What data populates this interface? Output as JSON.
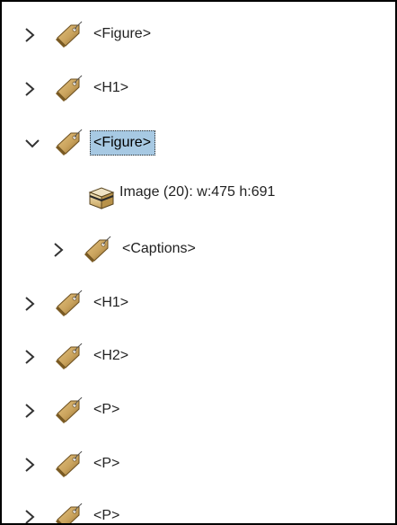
{
  "tree": {
    "nodes": [
      {
        "label": "<Figure>",
        "expanded": false,
        "selected": false
      },
      {
        "label": "<H1>",
        "expanded": false,
        "selected": false
      },
      {
        "label": "<Figure>",
        "expanded": true,
        "selected": true
      },
      {
        "label": "Image (20): w:475 h:691",
        "kind": "image"
      },
      {
        "label": "<Captions>",
        "expanded": false,
        "selected": false
      },
      {
        "label": "<H1>",
        "expanded": false,
        "selected": false
      },
      {
        "label": "<H2>",
        "expanded": false,
        "selected": false
      },
      {
        "label": "<P>",
        "expanded": false,
        "selected": false
      },
      {
        "label": "<P>",
        "expanded": false,
        "selected": false
      },
      {
        "label": "<P>",
        "expanded": false,
        "selected": false
      }
    ]
  },
  "colors": {
    "selection_bg": "#a7c9e3",
    "tag_fill": "#c9a25c",
    "border": "#000000"
  },
  "icons": {
    "collapsed": "chevron-right-icon",
    "expanded": "chevron-down-icon",
    "element": "tag-icon",
    "image": "image-box-icon"
  }
}
